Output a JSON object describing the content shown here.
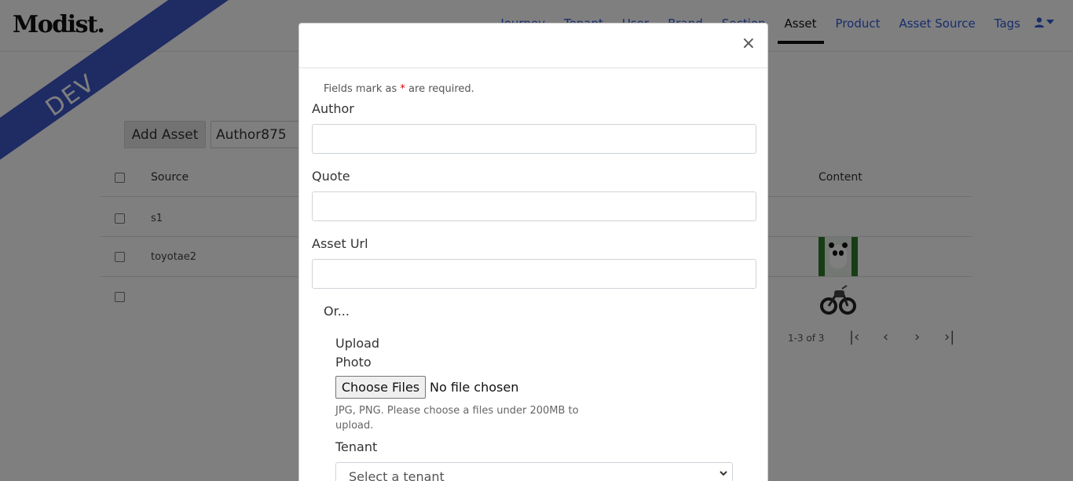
{
  "app": {
    "logo": "Modist.",
    "env_badge": "DEV"
  },
  "nav": {
    "items": [
      "Journey",
      "Tenant",
      "User",
      "Brand",
      "Section",
      "Asset",
      "Product",
      "Asset Source",
      "Tags"
    ],
    "active": "Asset",
    "user_icon": "user-icon"
  },
  "toolbar": {
    "add_label": "Add Asset",
    "search_value": "Author875"
  },
  "table": {
    "headers": {
      "source": "Source",
      "content": "Content"
    },
    "rows": [
      {
        "source": "s1",
        "content": ""
      },
      {
        "source": "toyotae2",
        "content": "panda-image"
      },
      {
        "source": "",
        "content": "motorcycle-image"
      }
    ]
  },
  "pagination": {
    "range_text": "1-3 of 3"
  },
  "modal": {
    "close": "×",
    "required_note_prefix": "Fields mark as ",
    "required_star": "*",
    "required_note_suffix": " are required.",
    "author_label": "Author",
    "quote_label": "Quote",
    "asset_url_label": "Asset Url",
    "or_label": "Or...",
    "upload_label_1": "Upload",
    "upload_label_2": "Photo",
    "choose_files": "Choose Files",
    "file_status": "No file chosen",
    "upload_help": "JPG, PNG. Please choose a files under 200MB to upload.",
    "tenant_label": "Tenant",
    "tenant_placeholder": "Select a tenant"
  },
  "colors": {
    "accent": "#2e5bd8",
    "ribbon": "#3f57c6",
    "required": "#dd0000"
  }
}
